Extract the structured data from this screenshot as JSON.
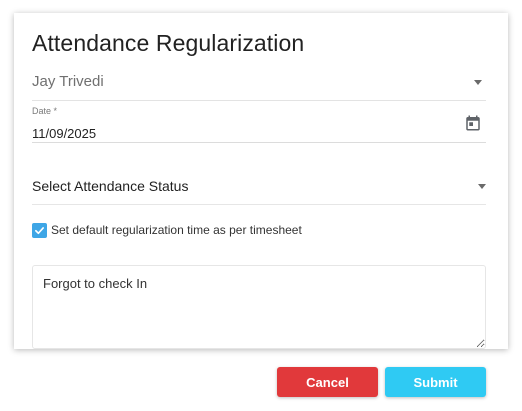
{
  "dialog": {
    "title": "Attendance Regularization"
  },
  "employee": {
    "selected": "Jay Trivedi",
    "icon": "chevron-down-icon"
  },
  "date": {
    "label": "Date *",
    "value": "11/09/2025",
    "icon": "calendar-icon"
  },
  "status": {
    "selected": "Select Attendance Status",
    "icon": "chevron-down-icon"
  },
  "default_time": {
    "checked": true,
    "label": "Set default regularization time as per timesheet"
  },
  "notes": {
    "value": "Forgot to check In"
  },
  "actions": {
    "cancel_label": "Cancel",
    "submit_label": "Submit"
  },
  "colors": {
    "accent": "#3ea6e6",
    "cancel": "#e1393b",
    "submit": "#2fcaf3"
  }
}
